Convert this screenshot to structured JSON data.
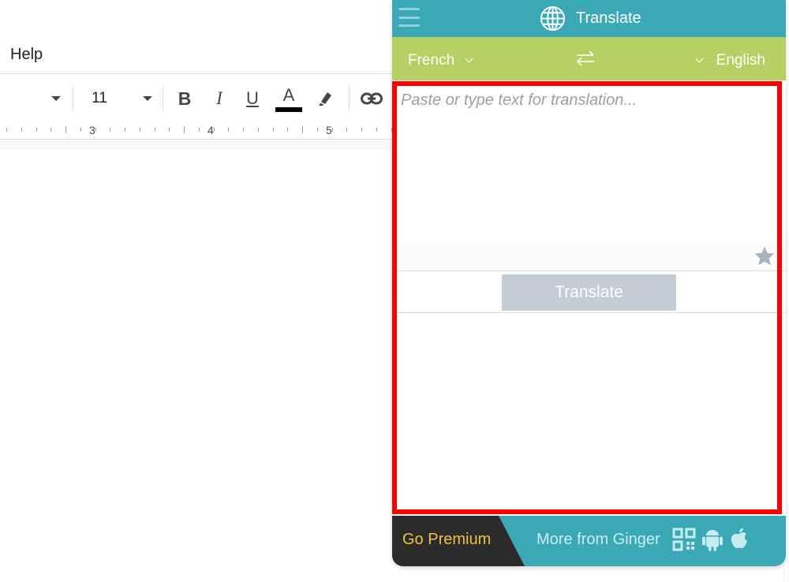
{
  "docs": {
    "menu_help": "Help",
    "font_size": "11",
    "format_bold": "B",
    "format_italic": "I",
    "format_underline": "U",
    "text_color": "A",
    "ruler_numbers": [
      "3",
      "4",
      "5"
    ]
  },
  "panel": {
    "title": "Translate",
    "source_language": "French",
    "target_language": "English",
    "input_placeholder": "Paste or type text for translation...",
    "input_value": "",
    "translate_button": "Translate",
    "output_text": "",
    "footer": {
      "premium_label": "Go Premium",
      "more_label": "More from Ginger"
    }
  },
  "colors": {
    "header_teal": "#3aa8b5",
    "language_bar_green": "#b7d065",
    "translate_button": "#c3cdd5",
    "premium_dark": "#2b2b2b",
    "premium_text": "#f0c040",
    "highlight_red": "#ff0000"
  },
  "icons": [
    "hamburger-menu-icon",
    "globe-icon",
    "swap-languages-icon",
    "star-icon",
    "qr-code-icon",
    "android-icon",
    "apple-icon",
    "highlighter-icon",
    "link-icon"
  ]
}
